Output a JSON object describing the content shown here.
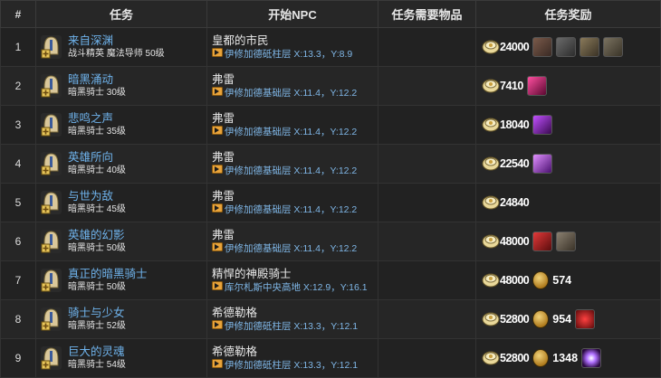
{
  "headers": {
    "num": "#",
    "quest": "任务",
    "npc": "开始NPC",
    "items": "任务需要物品",
    "rewards": "任务奖励"
  },
  "rows": [
    {
      "num": "1",
      "quest": "来自深渊",
      "sub": "战斗精英 魔法导师 50级",
      "npc": "皇都的市民",
      "loc": "伊修加德砥柱层 X:13.3，Y:8.9",
      "gil": "24000",
      "items": [
        "gear-icon",
        "sword-icon",
        "armor-icon",
        "boots-icon"
      ],
      "coin": null
    },
    {
      "num": "2",
      "quest": "暗黑涌动",
      "sub": "暗黑骑士 30级",
      "npc": "弗雷",
      "loc": "伊修加德基础层 X:11.4，Y:12.2",
      "gil": "7410",
      "items": [
        "pink-slash-icon"
      ],
      "coin": null
    },
    {
      "num": "3",
      "quest": "悲鸣之声",
      "sub": "暗黑骑士 35级",
      "npc": "弗雷",
      "loc": "伊修加德基础层 X:11.4，Y:12.2",
      "gil": "18040",
      "items": [
        "purple-slash-icon"
      ],
      "coin": null
    },
    {
      "num": "4",
      "quest": "英雄所向",
      "sub": "暗黑骑士 40级",
      "npc": "弗雷",
      "loc": "伊修加德基础层 X:11.4，Y:12.2",
      "gil": "22540",
      "items": [
        "violet-arc-icon"
      ],
      "coin": null
    },
    {
      "num": "5",
      "quest": "与世为敌",
      "sub": "暗黑骑士 45级",
      "npc": "弗雷",
      "loc": "伊修加德基础层 X:11.4，Y:12.2",
      "gil": "24840",
      "items": [],
      "coin": null
    },
    {
      "num": "6",
      "quest": "英雄的幻影",
      "sub": "暗黑骑士 50级",
      "npc": "弗雷",
      "loc": "伊修加德基础层 X:11.4，Y:12.2",
      "gil": "48000",
      "items": [
        "red-cube-icon",
        "gray-helm-icon"
      ],
      "coin": null
    },
    {
      "num": "7",
      "quest": "真正的暗黑骑士",
      "sub": "暗黑骑士 50级",
      "npc": "精悍的神殿骑士",
      "loc": "库尔札斯中央高地 X:12.9，Y:16.1",
      "gil": "48000",
      "items": [],
      "coin": "574"
    },
    {
      "num": "8",
      "quest": "骑士与少女",
      "sub": "暗黑骑士 52级",
      "npc": "希德勒格",
      "loc": "伊修加德砥柱层 X:13.3，Y:12.1",
      "gil": "52800",
      "items": [
        "red-orb-icon"
      ],
      "coin": "954"
    },
    {
      "num": "9",
      "quest": "巨大的灵魂",
      "sub": "暗黑骑士 54级",
      "npc": "希德勒格",
      "loc": "伊修加德砥柱层 X:13.3，Y:12.1",
      "gil": "52800",
      "items": [
        "purple-ring-icon"
      ],
      "coin": "1348"
    }
  ],
  "colors": {
    "quest_link": "#6fb3ec",
    "loc_link": "#7fb6e6",
    "map_icon": "#e8a33a"
  }
}
